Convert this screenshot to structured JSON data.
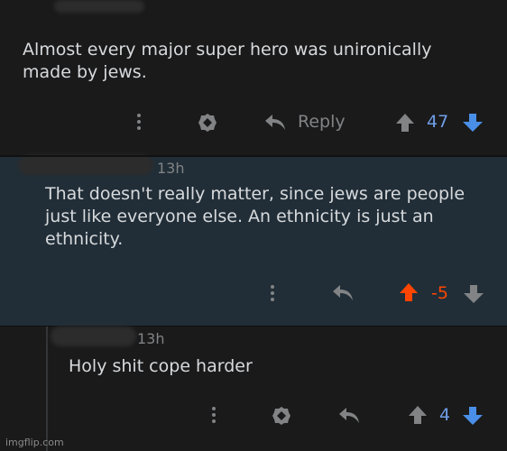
{
  "comments": [
    {
      "text": "Almost every major super hero was unironically\nmade by jews.",
      "reply_label": "Reply",
      "score": "47",
      "score_color": "#6e9ee6",
      "vote_state": "none"
    },
    {
      "time": "13h",
      "text": "That doesn't really matter, since jews are people\njust like everyone else. An ethnicity is just an\nethnicity.",
      "score": "-5",
      "score_color": "#ff4500",
      "vote_state": "upvoted"
    },
    {
      "time": "13h",
      "text": "Holy shit cope harder",
      "score": "4",
      "score_color": "#6e9ee6",
      "vote_state": "none"
    }
  ],
  "colors": {
    "upvote_active": "#ff4500",
    "downvote_blue": "#4a8fe7",
    "icon_gray": "#818384"
  },
  "watermark": "imgflip.com"
}
